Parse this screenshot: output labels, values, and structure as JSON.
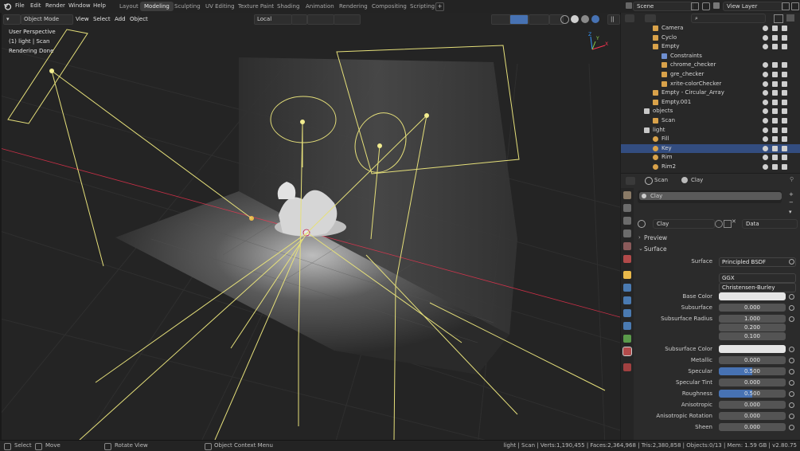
{
  "topbar": {
    "menus": [
      "File",
      "Edit",
      "Render",
      "Window",
      "Help"
    ],
    "workspaces": [
      "Layout",
      "Modeling",
      "Sculpting",
      "UV Editing",
      "Texture Paint",
      "Shading",
      "Animation",
      "Rendering",
      "Compositing",
      "Scripting"
    ],
    "active_workspace": "Modeling",
    "scene": "Scene",
    "view_layer": "View Layer"
  },
  "viewport": {
    "mode": "Object Mode",
    "menus": [
      "View",
      "Select",
      "Add",
      "Object"
    ],
    "orientation": "Local",
    "overlay_lines": [
      "User Perspective",
      "(1) light | Scan",
      "Rendering Done"
    ]
  },
  "outliner": {
    "rows": [
      {
        "name": "Camera",
        "type": "camera",
        "indent": 2,
        "selected": false
      },
      {
        "name": "Cyclo",
        "type": "mesh",
        "indent": 2,
        "selected": false
      },
      {
        "name": "Empty",
        "type": "empty",
        "indent": 2,
        "selected": false
      },
      {
        "name": "Constraints",
        "type": "constraint",
        "indent": 3,
        "selected": false
      },
      {
        "name": "chrome_checker",
        "type": "mesh",
        "indent": 3,
        "selected": false
      },
      {
        "name": "gre_checker",
        "type": "mesh",
        "indent": 3,
        "selected": false
      },
      {
        "name": "xrite-colorChecker",
        "type": "mesh",
        "indent": 3,
        "selected": false
      },
      {
        "name": "Empty - Circular_Array",
        "type": "empty",
        "indent": 2,
        "selected": false
      },
      {
        "name": "Empty.001",
        "type": "empty",
        "indent": 2,
        "selected": false
      },
      {
        "name": "objects",
        "type": "collection",
        "indent": 1,
        "selected": false
      },
      {
        "name": "Scan",
        "type": "mesh",
        "indent": 2,
        "selected": false
      },
      {
        "name": "light",
        "type": "collection",
        "indent": 1,
        "selected": false
      },
      {
        "name": "Fill",
        "type": "light",
        "indent": 2,
        "selected": false
      },
      {
        "name": "Key",
        "type": "light",
        "indent": 2,
        "selected": true
      },
      {
        "name": "Rim",
        "type": "light",
        "indent": 2,
        "selected": false
      },
      {
        "name": "Rim2",
        "type": "light",
        "indent": 2,
        "selected": false
      }
    ]
  },
  "properties": {
    "breadcrumb_object": "Scan",
    "breadcrumb_material": "Clay",
    "slot_name": "Clay",
    "material_name": "Clay",
    "link_target": "Data",
    "panels": [
      "Preview",
      "Surface"
    ],
    "surface_shader": "Principled BSDF",
    "distribution": "GGX",
    "subsurface_method": "Christensen-Burley",
    "rows": [
      {
        "label": "Base Color",
        "value": "",
        "kind": "color"
      },
      {
        "label": "Subsurface",
        "value": "0.000",
        "kind": "num"
      },
      {
        "label": "Subsurface Radius",
        "value": "1.000",
        "kind": "num"
      },
      {
        "label": "",
        "value": "0.200",
        "kind": "num"
      },
      {
        "label": "",
        "value": "0.100",
        "kind": "num"
      },
      {
        "label": "Subsurface Color",
        "value": "",
        "kind": "color"
      },
      {
        "label": "Metallic",
        "value": "0.000",
        "kind": "num"
      },
      {
        "label": "Specular",
        "value": "0.500",
        "kind": "slider",
        "fraction": 0.5
      },
      {
        "label": "Specular Tint",
        "value": "0.000",
        "kind": "num"
      },
      {
        "label": "Roughness",
        "value": "0.500",
        "kind": "slider",
        "fraction": 0.5
      },
      {
        "label": "Anisotropic",
        "value": "0.000",
        "kind": "num"
      },
      {
        "label": "Anisotropic Rotation",
        "value": "0.000",
        "kind": "num"
      },
      {
        "label": "Sheen",
        "value": "0.000",
        "kind": "num"
      }
    ]
  },
  "statusbar": {
    "select": "Select",
    "move": "Move",
    "rotate": "Rotate View",
    "context": "Object Context Menu",
    "stats": "light | Scan | Verts:1,190,455 | Faces:2,364,968 | Tris:2,380,858 | Objects:0/13 | Mem: 1.59 GB | v2.80.75"
  },
  "colors": {
    "accent": "#4772b3",
    "selection": "#334d80",
    "light_wire": "#e6e07a",
    "x_axis": "#ff3352"
  }
}
